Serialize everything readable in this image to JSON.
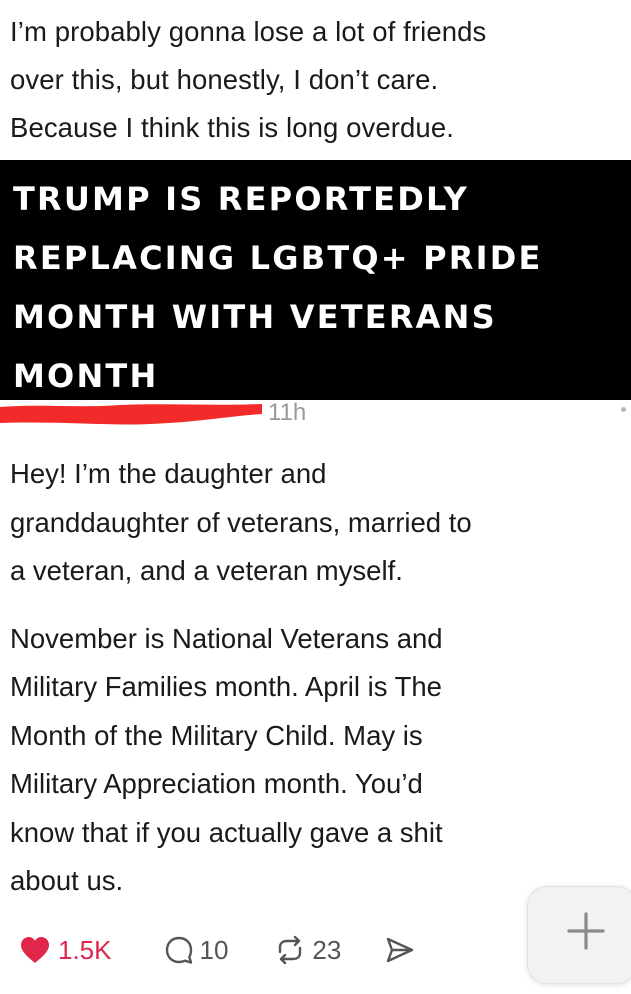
{
  "post": {
    "lines": [
      "I’m probably gonna lose a lot of friends",
      "over this, but honestly, I don’t care.",
      "Because I think this is long overdue."
    ]
  },
  "banner": {
    "lines": [
      "TRUMP IS REPORTEDLY",
      "REPLACING LGBTQ+ PRIDE",
      "MONTH WITH VETERANS",
      "MONTH"
    ]
  },
  "reply": {
    "time": "11h",
    "lines": [
      "Hey! I’m the daughter and",
      "granddaughter of veterans, married to",
      "a veteran, and a veteran myself.",
      "",
      "November is National Veterans and",
      "Military Families month. April is The",
      "Month of the Military Child. May is",
      "Military Appreciation month. You’d",
      "know that if you actually gave a shit",
      "about us."
    ]
  },
  "actions": {
    "likes": "1.5K",
    "replies": "10",
    "reposts": "23"
  },
  "colors": {
    "like": "#e0264b",
    "redaction": "#f22a2a"
  },
  "icons": {
    "like": "heart-icon",
    "reply": "comment-bubble-icon",
    "repost": "repost-icon",
    "share": "send-icon",
    "compose": "plus-icon"
  }
}
